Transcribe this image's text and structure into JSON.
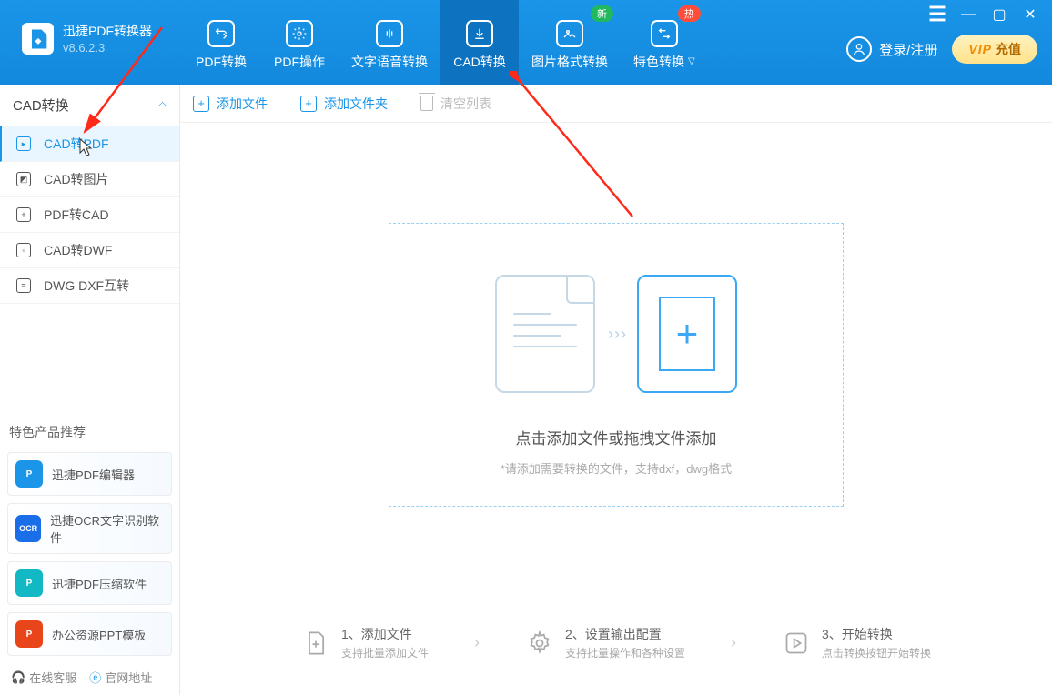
{
  "app": {
    "name": "迅捷PDF转换器",
    "version": "v8.6.2.3"
  },
  "header_tabs": [
    {
      "label": "PDF转换"
    },
    {
      "label": "PDF操作"
    },
    {
      "label": "文字语音转换"
    },
    {
      "label": "CAD转换"
    },
    {
      "label": "图片格式转换"
    },
    {
      "label": "特色转换"
    }
  ],
  "badges": {
    "new": "新",
    "hot": "热"
  },
  "login_label": "登录/注册",
  "vip": {
    "text": "VIP",
    "action": "充值"
  },
  "sidebar": {
    "header": "CAD转换",
    "items": [
      {
        "label": "CAD转PDF"
      },
      {
        "label": "CAD转图片"
      },
      {
        "label": "PDF转CAD"
      },
      {
        "label": "CAD转DWF"
      },
      {
        "label": "DWG DXF互转"
      }
    ]
  },
  "promo_title": "特色产品推荐",
  "promos": [
    {
      "label": "迅捷PDF编辑器",
      "color": "#1a95e8",
      "badge": "P"
    },
    {
      "label": "迅捷OCR文字识别软件",
      "color": "#1a6fe8",
      "badge": "OCR"
    },
    {
      "label": "迅捷PDF压缩软件",
      "color": "#12b8c4",
      "badge": "P"
    },
    {
      "label": "办公资源PPT模板",
      "color": "#e8451a",
      "badge": "P"
    }
  ],
  "footer": {
    "kefu": "在线客服",
    "site": "官网地址"
  },
  "toolbar": {
    "add_file": "添加文件",
    "add_folder": "添加文件夹",
    "clear": "清空列表"
  },
  "dropzone": {
    "title": "点击添加文件或拖拽文件添加",
    "hint": "*请添加需要转换的文件，支持dxf，dwg格式"
  },
  "steps": [
    {
      "title": "1、添加文件",
      "sub": "支持批量添加文件"
    },
    {
      "title": "2、设置输出配置",
      "sub": "支持批量操作和各种设置"
    },
    {
      "title": "3、开始转换",
      "sub": "点击转换按钮开始转换"
    }
  ]
}
